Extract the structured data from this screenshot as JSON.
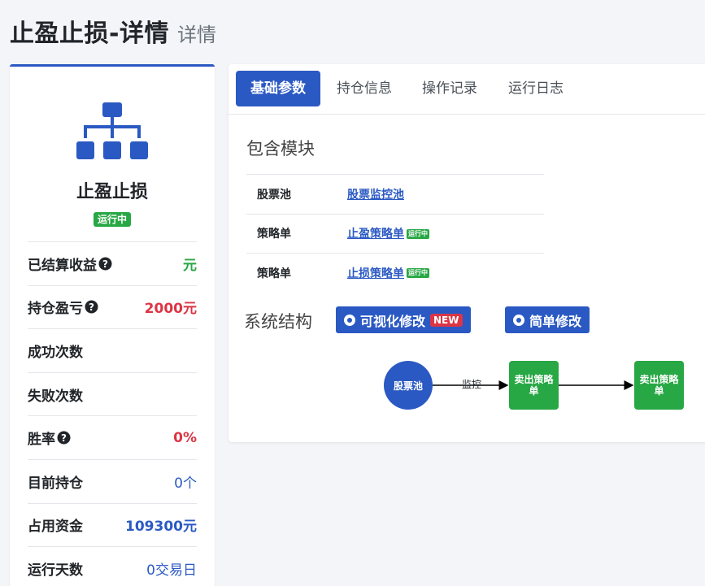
{
  "header": {
    "title": "止盈止损-详情",
    "subtitle": "详情"
  },
  "strategy": {
    "icon": "sitemap-icon",
    "name": "止盈止损",
    "status": "运行中"
  },
  "stats": [
    {
      "label": "已结算收益",
      "help": true,
      "value": "元",
      "tone": "green"
    },
    {
      "label": "持仓盈亏",
      "help": true,
      "value": "2000元",
      "tone": "red"
    },
    {
      "label": "成功次数",
      "help": false,
      "value": "",
      "tone": ""
    },
    {
      "label": "失败次数",
      "help": false,
      "value": "",
      "tone": ""
    },
    {
      "label": "胜率",
      "help": true,
      "value": "0%",
      "tone": "red"
    },
    {
      "label": "目前持仓",
      "help": false,
      "value": "0个",
      "tone": "blue"
    },
    {
      "label": "占用资金",
      "help": false,
      "value": "109300元",
      "tone": "blue-bold"
    },
    {
      "label": "运行天数",
      "help": false,
      "value": "0交易日",
      "tone": "blue"
    }
  ],
  "tabs": [
    {
      "label": "基础参数",
      "active": true
    },
    {
      "label": "持仓信息",
      "active": false
    },
    {
      "label": "操作记录",
      "active": false
    },
    {
      "label": "运行日志",
      "active": false
    }
  ],
  "modules": {
    "title": "包含模块",
    "rows": [
      {
        "label": "股票池",
        "link": "股票监控池",
        "badge": ""
      },
      {
        "label": "策略单",
        "link": "止盈策略单",
        "badge": "运行中"
      },
      {
        "label": "策略单",
        "link": "止损策略单",
        "badge": "运行中"
      }
    ]
  },
  "structure": {
    "title": "系统结构",
    "visual_edit_label": "可视化修改",
    "new_badge": "NEW",
    "simple_edit_label": "简单修改",
    "flow": {
      "source": "股票池",
      "edge_label": "监控",
      "node1": "卖出策略单",
      "node2": "卖出策略单"
    }
  },
  "colors": {
    "primary": "#2b59c3",
    "success": "#28a745",
    "danger": "#dc3545"
  }
}
